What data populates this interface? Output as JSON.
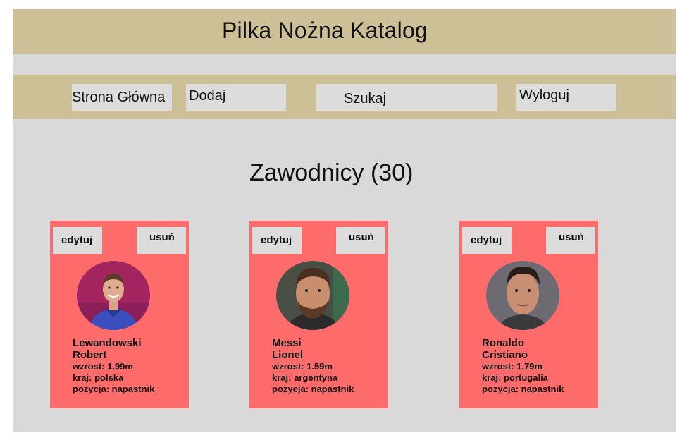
{
  "header": {
    "title": "Pilka Nożna Katalog"
  },
  "nav": {
    "home": "Strona Główna",
    "add": "Dodaj",
    "search": "Szukaj",
    "logout": "Wyloguj"
  },
  "main": {
    "count_heading": "Zawodnicy (30)"
  },
  "players": [
    {
      "edit": "edytuj",
      "delete": "usuń",
      "surname": "Lewandowski",
      "firstname": "Robert",
      "height": "wzrost: 1.99m",
      "country": "kraj: polska",
      "position": "pozycja: napastnik"
    },
    {
      "edit": "edytuj",
      "delete": "usuń",
      "surname": "Messi",
      "firstname": "Lionel",
      "height": "wzrost: 1.59m",
      "country": "kraj: argentyna",
      "position": "pozycja: napastnik"
    },
    {
      "edit": "edytuj",
      "delete": "usuń",
      "surname": "Ronaldo",
      "firstname": "Cristiano",
      "height": "wzrost: 1.79m",
      "country": "kraj: portugalia",
      "position": "pozycja: napastnik"
    }
  ],
  "colors": {
    "header_bg": "#cdbf96",
    "page_bg": "#d9d9d9",
    "card_bg": "#fe6b6b",
    "button_bg": "#dcdcdc"
  }
}
